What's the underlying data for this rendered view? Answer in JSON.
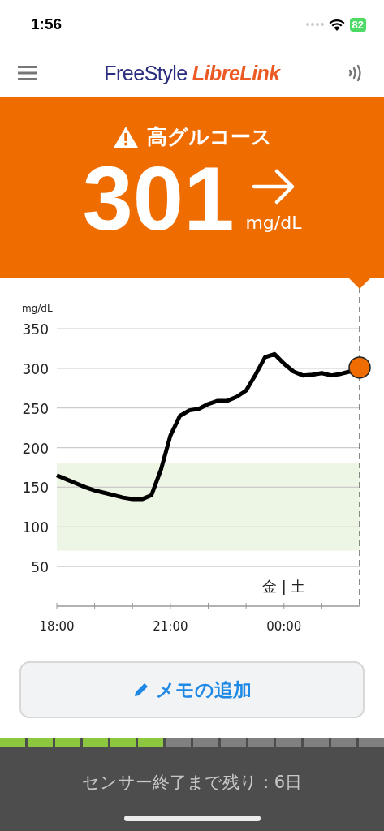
{
  "status_bar": {
    "time": "1:56",
    "battery": "82"
  },
  "header": {
    "logo": {
      "first": "FreeStyle",
      "second": "LibreLink"
    }
  },
  "alert": {
    "title": "高グルコース",
    "value": "301",
    "unit": "mg/dL"
  },
  "chart": {
    "chart_data": {
      "type": "line",
      "ylabel": "mg/dL",
      "ylim": [
        0,
        350
      ],
      "grid": true,
      "yticks": [
        50,
        100,
        150,
        200,
        250,
        300,
        350
      ],
      "categories": [
        "18:00",
        null,
        null,
        null,
        null,
        null,
        null,
        null,
        null,
        null,
        null,
        null,
        "21:00",
        null,
        null,
        null,
        null,
        null,
        null,
        null,
        null,
        null,
        null,
        null,
        "00:00",
        null,
        null,
        null,
        null,
        null,
        null,
        null,
        null
      ],
      "series": [
        {
          "color": "#000000",
          "values": [
            165,
            160,
            155,
            150,
            146,
            143,
            140,
            137,
            135,
            135,
            140,
            172,
            215,
            240,
            247,
            249,
            255,
            259,
            259,
            264,
            272,
            292,
            314,
            318,
            306,
            296,
            291,
            292,
            294,
            291,
            293,
            296,
            301
          ]
        }
      ],
      "bands": [
        {
          "axis": "y",
          "from": 70,
          "to": 180,
          "color": "#edf5e4"
        }
      ]
    },
    "day_label": "金 | 土"
  },
  "memo_button": {
    "label": "メモの追加"
  },
  "sensor": {
    "segments": [
      {
        "filled": true
      },
      {
        "filled": true
      },
      {
        "filled": true
      },
      {
        "filled": true
      },
      {
        "filled": true
      },
      {
        "filled": true
      },
      {
        "filled": false
      },
      {
        "filled": false
      },
      {
        "filled": false
      },
      {
        "filled": false
      },
      {
        "filled": false
      },
      {
        "filled": false
      },
      {
        "filled": false
      },
      {
        "filled": false
      }
    ],
    "message": "センサー終了まで残り：6日"
  }
}
